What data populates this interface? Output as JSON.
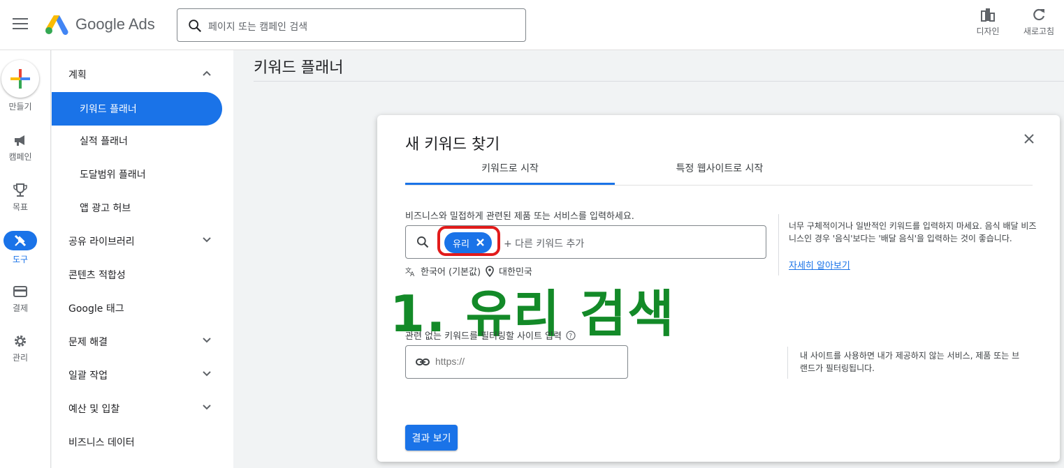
{
  "app": {
    "logo_text": "Google Ads",
    "search_placeholder": "페이지 또는 캠페인 검색",
    "actions": [
      {
        "label": "디자인",
        "icon": "appearance-icon"
      },
      {
        "label": "새로고침",
        "icon": "refresh-icon"
      }
    ]
  },
  "rail": {
    "items": [
      {
        "label": "만들기",
        "icon": "plus-icon"
      },
      {
        "label": "캠페인",
        "icon": "megaphone-icon"
      },
      {
        "label": "목표",
        "icon": "trophy-icon"
      },
      {
        "label": "도구",
        "icon": "tools-icon",
        "active": true
      },
      {
        "label": "결제",
        "icon": "credit-card-icon"
      },
      {
        "label": "관리",
        "icon": "gear-icon"
      }
    ]
  },
  "nav": {
    "items": [
      {
        "label": "계획",
        "chevron": "up"
      },
      {
        "label": "키워드 플래너",
        "active": true
      },
      {
        "label": "실적 플래너"
      },
      {
        "label": "도달범위 플래너"
      },
      {
        "label": "앱 광고 허브"
      },
      {
        "label": "공유 라이브러리",
        "chevron": "down"
      },
      {
        "label": "콘텐츠 적합성"
      },
      {
        "label": "Google 태그"
      },
      {
        "label": "문제 해결",
        "chevron": "down"
      },
      {
        "label": "일괄 작업",
        "chevron": "down"
      },
      {
        "label": "예산 및 입찰",
        "chevron": "down"
      },
      {
        "label": "비즈니스 데이터"
      }
    ]
  },
  "main": {
    "title": "키워드 플래너"
  },
  "dialog": {
    "title": "새 키워드 찾기",
    "tabs": [
      {
        "label": "키워드로 시작",
        "active": true
      },
      {
        "label": "특정 웹사이트로 시작"
      }
    ],
    "keyword_label": "비즈니스와 밀접하게 관련된 제품 또는 서비스를 입력하세요.",
    "chip": "유리",
    "add_placeholder": "+ 다른 키워드 추가",
    "language": "한국어 (기본값)",
    "location": "대한민국",
    "keyword_tip": "너무 구체적이거나 일반적인 키워드를 입력하지 마세요. 음식 배달 비즈니스인 경우 '음식'보다는 '배달 음식'을 입력하는 것이 좋습니다.",
    "learn_more": "자세히 알아보기",
    "overlay_annotation": "1. 유리 검색",
    "filter_label": "관련 없는 키워드를 필터링할 사이트 입력",
    "url_placeholder": "https://",
    "filter_tip": "내 사이트를 사용하면 내가 제공하지 않는 서비스, 제품 또는 브랜드가 필터링됩니다.",
    "result_button": "결과 보기"
  },
  "colors": {
    "accent": "#1a73e8",
    "annotation_green": "#138a28",
    "highlight_red": "#e21b1b"
  }
}
